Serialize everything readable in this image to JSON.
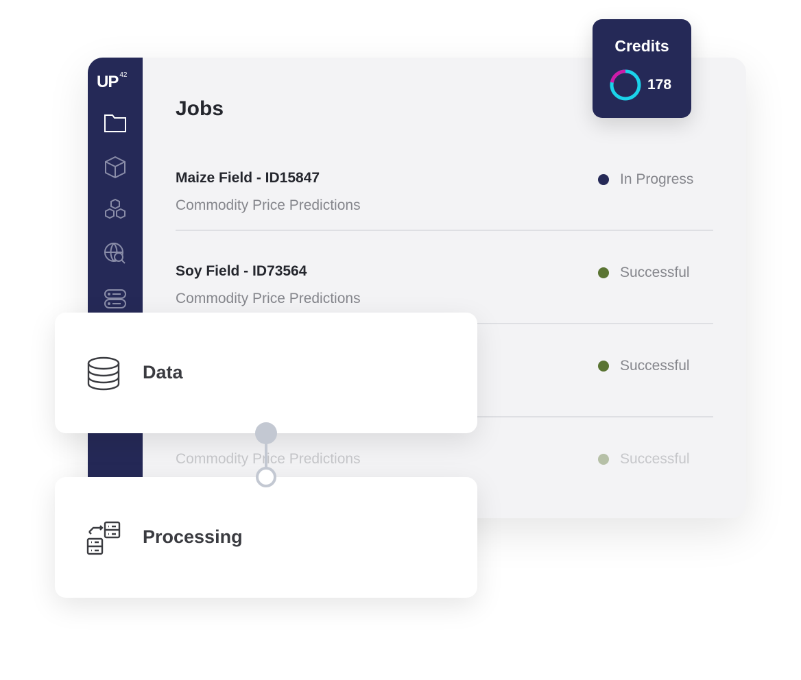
{
  "brand": {
    "logo": "UP",
    "logo_sup": "42"
  },
  "sidebar": {
    "items": [
      {
        "icon": "folder-icon",
        "active": true
      },
      {
        "icon": "cube-icon"
      },
      {
        "icon": "cubes-icon"
      },
      {
        "icon": "globe-search-icon"
      },
      {
        "icon": "server-icon"
      }
    ]
  },
  "main": {
    "title": "Jobs",
    "jobs": [
      {
        "title": "Maize Field - ID15847",
        "subtitle": "Commodity Price Predictions",
        "status": "In Progress",
        "status_color": "#252957"
      },
      {
        "title": "Soy Field - ID73564",
        "subtitle": "Commodity Price Predictions",
        "status": "Successful",
        "status_color": "#5a7433"
      },
      {
        "status": "Successful",
        "status_color": "#5a7433"
      },
      {
        "subtitle": "Commodity Price Predictions",
        "status": "Successful",
        "status_color": "#5a7433"
      }
    ]
  },
  "credits": {
    "label": "Credits",
    "value": "178",
    "used_fraction": 0.22,
    "colors": {
      "used": "#d01aa8",
      "remaining": "#1bd3ea"
    }
  },
  "cards": {
    "data": {
      "label": "Data",
      "icon": "database-icon"
    },
    "processing": {
      "label": "Processing",
      "icon": "processing-icon"
    }
  },
  "colors": {
    "navy": "#252957",
    "panel": "#f3f3f5"
  }
}
